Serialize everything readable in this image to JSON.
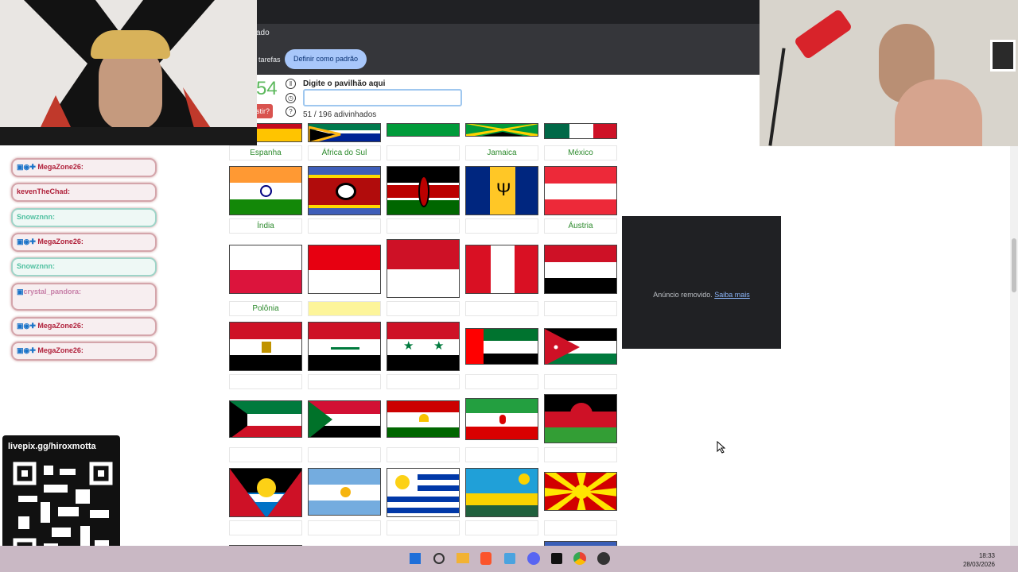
{
  "browser": {
    "tab_fragment": "ado",
    "taskbar_fragment": "tarefas",
    "default_button": "Definir como padrão"
  },
  "quiz": {
    "score": "54",
    "quit_label": "stir?",
    "prompt": "Digite o pavilhão aqui",
    "answer_value": "",
    "counter": "51 / 196 adivinhados",
    "pause_icon": "pause-icon",
    "clock_icon": "clock-icon",
    "help_icon": "?"
  },
  "grid": {
    "rows": [
      {
        "labels": [
          "Espanha",
          "África do Sul",
          "",
          "Jamaica",
          "México"
        ]
      },
      {
        "labels": [
          "Índia",
          "",
          "",
          "",
          "Áustria"
        ]
      },
      {
        "labels": [
          "Polônia",
          "",
          "",
          "",
          ""
        ]
      },
      {
        "labels": [
          "",
          "",
          "",
          "",
          ""
        ]
      },
      {
        "labels": [
          "",
          "",
          "",
          "",
          ""
        ]
      },
      {
        "labels": [
          "",
          "",
          "",
          "",
          ""
        ]
      }
    ]
  },
  "ad": {
    "text": "Anúncio removido.",
    "link": "Saiba mais"
  },
  "chat": {
    "messages": [
      {
        "user": "MegaZone26:",
        "badges": true
      },
      {
        "user": "kevenTheChad:",
        "badges": false
      },
      {
        "user": "Snowznnn:",
        "badges": false,
        "green": true
      },
      {
        "user": "MegaZone26:",
        "badges": true
      },
      {
        "user": "Snowznnn:",
        "badges": false,
        "green": true
      },
      {
        "user": "crystal_pandora:",
        "badges": true
      },
      {
        "user": "MegaZone26:",
        "badges": true
      },
      {
        "user": "MegaZone26:",
        "badges": true
      }
    ]
  },
  "overlay": {
    "livepix": "livepix.gg/hiroxmotta"
  },
  "taskbar": {
    "time": "18:33",
    "date": "28/03/2026"
  },
  "colors": {
    "correct_label": "#2e8b2e",
    "highlight_label": "#fdf59a",
    "score": "#5cb85c",
    "quit": "#d9534f"
  }
}
